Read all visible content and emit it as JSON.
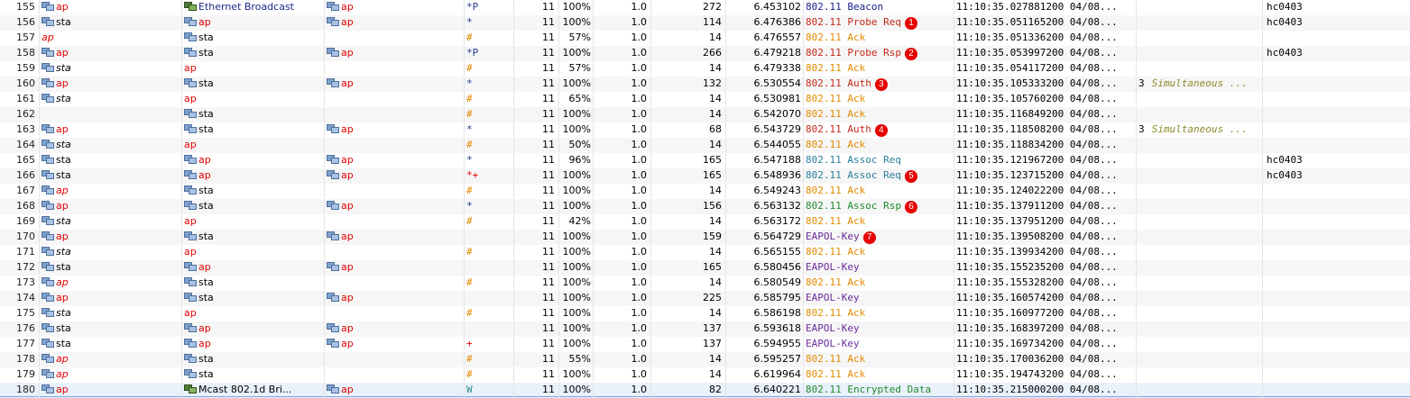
{
  "colors": {
    "address_red": "#e00000",
    "address_plain": "#222222",
    "marker_red": "#e60000",
    "protocol_dark": "#19218a",
    "protocol_red": "#c42a1a",
    "protocol_orange": "#e38a00",
    "protocol_teal": "#2a7f9a",
    "protocol_green": "#1f8a2a",
    "protocol_purple": "#6b2b9c"
  },
  "rows": [
    {
      "no": "155",
      "src": "ap",
      "src_style": "red",
      "src_icon": "node-icon",
      "dst": "Ethernet Broadcast",
      "dst_style": "navy",
      "dst_icon": "broadcast-icon",
      "bssid": "ap",
      "bssid_style": "red",
      "flags": "*P",
      "flag_style": "flag-blue",
      "ch": "11",
      "sig": "100%",
      "rate": "1.0",
      "size": "272",
      "time": "6.453102",
      "proto": "802.11 Beacon",
      "proto_style": "pr-dark",
      "ts": "11:10:35.027881200 04/08...",
      "expert": "",
      "ssid": "Beacon",
      "ssid2": "hc0403",
      "marker": ""
    },
    {
      "no": "156",
      "src": "sta",
      "src_style": "plain",
      "src_icon": "node-icon",
      "dst": "ap",
      "dst_style": "red",
      "dst_icon": "node-icon",
      "bssid": "ap",
      "bssid_style": "red",
      "flags": "*",
      "flag_style": "flag-blue",
      "ch": "11",
      "sig": "100%",
      "rate": "1.0",
      "size": "114",
      "time": "6.476386",
      "proto": "802.11 Probe Req",
      "proto_style": "pr-red",
      "ts": "11:10:35.051165200 04/08...",
      "expert": "",
      "ssid": "",
      "ssid2": "hc0403",
      "marker": "1"
    },
    {
      "no": "157",
      "src": "ap",
      "src_style": "red-ital",
      "src_icon": "",
      "dst": "sta",
      "dst_style": "plain",
      "dst_icon": "node-icon",
      "bssid": "",
      "bssid_style": "",
      "flags": "#",
      "flag_style": "flag-orange",
      "ch": "11",
      "sig": "57%",
      "rate": "1.0",
      "size": "14",
      "time": "6.476557",
      "proto": "802.11 Ack",
      "proto_style": "pr-orange",
      "ts": "11:10:35.051336200 04/08...",
      "expert": "",
      "ssid": "",
      "ssid2": "",
      "marker": ""
    },
    {
      "no": "158",
      "src": "ap",
      "src_style": "red",
      "src_icon": "node-icon",
      "dst": "sta",
      "dst_style": "plain",
      "dst_icon": "node-icon",
      "bssid": "ap",
      "bssid_style": "red",
      "flags": "*P",
      "flag_style": "flag-blue",
      "ch": "11",
      "sig": "100%",
      "rate": "1.0",
      "size": "266",
      "time": "6.479218",
      "proto": "802.11 Probe Rsp",
      "proto_style": "pr-red",
      "ts": "11:10:35.053997200 04/08...",
      "expert": "",
      "ssid": "",
      "ssid2": "hc0403",
      "marker": "2"
    },
    {
      "no": "159",
      "src": "sta",
      "src_style": "plain-ital",
      "src_icon": "node-icon",
      "dst": "ap",
      "dst_style": "red",
      "dst_icon": "",
      "bssid": "",
      "bssid_style": "",
      "flags": "#",
      "flag_style": "flag-orange",
      "ch": "11",
      "sig": "57%",
      "rate": "1.0",
      "size": "14",
      "time": "6.479338",
      "proto": "802.11 Ack",
      "proto_style": "pr-orange",
      "ts": "11:10:35.054117200 04/08...",
      "expert": "",
      "ssid": "",
      "ssid2": "",
      "marker": ""
    },
    {
      "no": "160",
      "src": "ap",
      "src_style": "red",
      "src_icon": "node-icon",
      "dst": "sta",
      "dst_style": "plain",
      "dst_icon": "node-icon",
      "bssid": "ap",
      "bssid_style": "red",
      "flags": "*",
      "flag_style": "flag-blue",
      "ch": "11",
      "sig": "100%",
      "rate": "1.0",
      "size": "132",
      "time": "6.530554",
      "proto": "802.11 Auth",
      "proto_style": "pr-red",
      "ts": "11:10:35.105333200 04/08...",
      "expert": "3",
      "expert_text": "Simultaneous ...",
      "ssid": "",
      "ssid2": "",
      "marker": "3"
    },
    {
      "no": "161",
      "src": "sta",
      "src_style": "plain-ital",
      "src_icon": "node-icon",
      "dst": "ap",
      "dst_style": "red",
      "dst_icon": "",
      "bssid": "",
      "bssid_style": "",
      "flags": "#",
      "flag_style": "flag-orange",
      "ch": "11",
      "sig": "65%",
      "rate": "1.0",
      "size": "14",
      "time": "6.530981",
      "proto": "802.11 Ack",
      "proto_style": "pr-orange",
      "ts": "11:10:35.105760200 04/08...",
      "expert": "",
      "ssid": "",
      "ssid2": "",
      "marker": ""
    },
    {
      "no": "162",
      "src": "",
      "src_style": "",
      "src_icon": "",
      "dst": "sta",
      "dst_style": "plain",
      "dst_icon": "node-icon",
      "bssid": "",
      "bssid_style": "",
      "flags": "#",
      "flag_style": "flag-orange",
      "ch": "11",
      "sig": "100%",
      "rate": "1.0",
      "size": "14",
      "time": "6.542070",
      "proto": "802.11 Ack",
      "proto_style": "pr-orange",
      "ts": "11:10:35.116849200 04/08...",
      "expert": "",
      "ssid": "",
      "ssid2": "",
      "marker": ""
    },
    {
      "no": "163",
      "src": "ap",
      "src_style": "red",
      "src_icon": "node-icon",
      "dst": "sta",
      "dst_style": "plain",
      "dst_icon": "node-icon",
      "bssid": "ap",
      "bssid_style": "red",
      "flags": "*",
      "flag_style": "flag-blue",
      "ch": "11",
      "sig": "100%",
      "rate": "1.0",
      "size": "68",
      "time": "6.543729",
      "proto": "802.11 Auth",
      "proto_style": "pr-red",
      "ts": "11:10:35.118508200 04/08...",
      "expert": "3",
      "expert_text": "Simultaneous ...",
      "ssid": "",
      "ssid2": "",
      "marker": "4"
    },
    {
      "no": "164",
      "src": "sta",
      "src_style": "plain-ital",
      "src_icon": "node-icon",
      "dst": "ap",
      "dst_style": "red",
      "dst_icon": "",
      "bssid": "",
      "bssid_style": "",
      "flags": "#",
      "flag_style": "flag-orange",
      "ch": "11",
      "sig": "50%",
      "rate": "1.0",
      "size": "14",
      "time": "6.544055",
      "proto": "802.11 Ack",
      "proto_style": "pr-orange",
      "ts": "11:10:35.118834200 04/08...",
      "expert": "",
      "ssid": "",
      "ssid2": "",
      "marker": ""
    },
    {
      "no": "165",
      "src": "sta",
      "src_style": "plain",
      "src_icon": "node-icon",
      "dst": "ap",
      "dst_style": "red",
      "dst_icon": "node-icon",
      "bssid": "ap",
      "bssid_style": "red",
      "flags": "*",
      "flag_style": "flag-blue",
      "ch": "11",
      "sig": "96%",
      "rate": "1.0",
      "size": "165",
      "time": "6.547188",
      "proto": "802.11 Assoc Req",
      "proto_style": "pr-teal",
      "ts": "11:10:35.121967200 04/08...",
      "expert": "",
      "ssid": "",
      "ssid2": "hc0403",
      "marker": ""
    },
    {
      "no": "166",
      "src": "sta",
      "src_style": "plain",
      "src_icon": "node-icon",
      "dst": "ap",
      "dst_style": "red",
      "dst_icon": "node-icon",
      "bssid": "ap",
      "bssid_style": "red",
      "flags": "*+",
      "flag_style": "flag-red",
      "ch": "11",
      "sig": "100%",
      "rate": "1.0",
      "size": "165",
      "time": "6.548936",
      "proto": "802.11 Assoc Req",
      "proto_style": "pr-teal",
      "ts": "11:10:35.123715200 04/08...",
      "expert": "",
      "ssid": "",
      "ssid2": "hc0403",
      "marker": "5"
    },
    {
      "no": "167",
      "src": "ap",
      "src_style": "red-ital",
      "src_icon": "node-icon",
      "dst": "sta",
      "dst_style": "plain",
      "dst_icon": "node-icon",
      "bssid": "",
      "bssid_style": "",
      "flags": "#",
      "flag_style": "flag-orange",
      "ch": "11",
      "sig": "100%",
      "rate": "1.0",
      "size": "14",
      "time": "6.549243",
      "proto": "802.11 Ack",
      "proto_style": "pr-orange",
      "ts": "11:10:35.124022200 04/08...",
      "expert": "",
      "ssid": "",
      "ssid2": "",
      "marker": ""
    },
    {
      "no": "168",
      "src": "ap",
      "src_style": "red",
      "src_icon": "node-icon",
      "dst": "sta",
      "dst_style": "plain",
      "dst_icon": "node-icon",
      "bssid": "ap",
      "bssid_style": "red",
      "flags": "*",
      "flag_style": "flag-blue",
      "ch": "11",
      "sig": "100%",
      "rate": "1.0",
      "size": "156",
      "time": "6.563132",
      "proto": "802.11 Assoc Rsp",
      "proto_style": "pr-green",
      "ts": "11:10:35.137911200 04/08...",
      "expert": "",
      "ssid": "",
      "ssid2": "",
      "marker": "6"
    },
    {
      "no": "169",
      "src": "sta",
      "src_style": "plain-ital",
      "src_icon": "node-icon",
      "dst": "ap",
      "dst_style": "red",
      "dst_icon": "",
      "bssid": "",
      "bssid_style": "",
      "flags": "#",
      "flag_style": "flag-orange",
      "ch": "11",
      "sig": "42%",
      "rate": "1.0",
      "size": "14",
      "time": "6.563172",
      "proto": "802.11 Ack",
      "proto_style": "pr-orange",
      "ts": "11:10:35.137951200 04/08...",
      "expert": "",
      "ssid": "",
      "ssid2": "",
      "marker": ""
    },
    {
      "no": "170",
      "src": "ap",
      "src_style": "red",
      "src_icon": "node-icon",
      "dst": "sta",
      "dst_style": "plain",
      "dst_icon": "node-icon",
      "bssid": "ap",
      "bssid_style": "red",
      "flags": "",
      "flag_style": "",
      "ch": "11",
      "sig": "100%",
      "rate": "1.0",
      "size": "159",
      "time": "6.564729",
      "proto": "EAPOL-Key",
      "proto_style": "pr-purple",
      "ts": "11:10:35.139508200 04/08...",
      "expert": "",
      "ssid": "",
      "ssid2": "",
      "marker": "7"
    },
    {
      "no": "171",
      "src": "sta",
      "src_style": "plain-ital",
      "src_icon": "node-icon",
      "dst": "ap",
      "dst_style": "red",
      "dst_icon": "",
      "bssid": "",
      "bssid_style": "",
      "flags": "#",
      "flag_style": "flag-orange",
      "ch": "11",
      "sig": "100%",
      "rate": "1.0",
      "size": "14",
      "time": "6.565155",
      "proto": "802.11 Ack",
      "proto_style": "pr-orange",
      "ts": "11:10:35.139934200 04/08...",
      "expert": "",
      "ssid": "",
      "ssid2": "",
      "marker": ""
    },
    {
      "no": "172",
      "src": "sta",
      "src_style": "plain",
      "src_icon": "node-icon",
      "dst": "ap",
      "dst_style": "red",
      "dst_icon": "node-icon",
      "bssid": "ap",
      "bssid_style": "red",
      "flags": "",
      "flag_style": "",
      "ch": "11",
      "sig": "100%",
      "rate": "1.0",
      "size": "165",
      "time": "6.580456",
      "proto": "EAPOL-Key",
      "proto_style": "pr-purple",
      "ts": "11:10:35.155235200 04/08...",
      "expert": "",
      "ssid": "",
      "ssid2": "",
      "marker": ""
    },
    {
      "no": "173",
      "src": "ap",
      "src_style": "red-ital",
      "src_icon": "node-icon",
      "dst": "sta",
      "dst_style": "plain",
      "dst_icon": "node-icon",
      "bssid": "",
      "bssid_style": "",
      "flags": "#",
      "flag_style": "flag-orange",
      "ch": "11",
      "sig": "100%",
      "rate": "1.0",
      "size": "14",
      "time": "6.580549",
      "proto": "802.11 Ack",
      "proto_style": "pr-orange",
      "ts": "11:10:35.155328200 04/08...",
      "expert": "",
      "ssid": "",
      "ssid2": "",
      "marker": ""
    },
    {
      "no": "174",
      "src": "ap",
      "src_style": "red",
      "src_icon": "node-icon",
      "dst": "sta",
      "dst_style": "plain",
      "dst_icon": "node-icon",
      "bssid": "ap",
      "bssid_style": "red",
      "flags": "",
      "flag_style": "",
      "ch": "11",
      "sig": "100%",
      "rate": "1.0",
      "size": "225",
      "time": "6.585795",
      "proto": "EAPOL-Key",
      "proto_style": "pr-purple",
      "ts": "11:10:35.160574200 04/08...",
      "expert": "",
      "ssid": "",
      "ssid2": "",
      "marker": ""
    },
    {
      "no": "175",
      "src": "sta",
      "src_style": "plain-ital",
      "src_icon": "node-icon",
      "dst": "ap",
      "dst_style": "red",
      "dst_icon": "",
      "bssid": "",
      "bssid_style": "",
      "flags": "#",
      "flag_style": "flag-orange",
      "ch": "11",
      "sig": "100%",
      "rate": "1.0",
      "size": "14",
      "time": "6.586198",
      "proto": "802.11 Ack",
      "proto_style": "pr-orange",
      "ts": "11:10:35.160977200 04/08...",
      "expert": "",
      "ssid": "",
      "ssid2": "",
      "marker": ""
    },
    {
      "no": "176",
      "src": "sta",
      "src_style": "plain",
      "src_icon": "node-icon",
      "dst": "ap",
      "dst_style": "red",
      "dst_icon": "node-icon",
      "bssid": "ap",
      "bssid_style": "red",
      "flags": "",
      "flag_style": "",
      "ch": "11",
      "sig": "100%",
      "rate": "1.0",
      "size": "137",
      "time": "6.593618",
      "proto": "EAPOL-Key",
      "proto_style": "pr-purple",
      "ts": "11:10:35.168397200 04/08...",
      "expert": "",
      "ssid": "",
      "ssid2": "",
      "marker": ""
    },
    {
      "no": "177",
      "src": "sta",
      "src_style": "plain",
      "src_icon": "node-icon",
      "dst": "ap",
      "dst_style": "red",
      "dst_icon": "node-icon",
      "bssid": "ap",
      "bssid_style": "red",
      "flags": "+",
      "flag_style": "flag-red",
      "ch": "11",
      "sig": "100%",
      "rate": "1.0",
      "size": "137",
      "time": "6.594955",
      "proto": "EAPOL-Key",
      "proto_style": "pr-purple",
      "ts": "11:10:35.169734200 04/08...",
      "expert": "",
      "ssid": "",
      "ssid2": "",
      "marker": ""
    },
    {
      "no": "178",
      "src": "ap",
      "src_style": "red-ital",
      "src_icon": "node-icon",
      "dst": "sta",
      "dst_style": "plain",
      "dst_icon": "node-icon",
      "bssid": "",
      "bssid_style": "",
      "flags": "#",
      "flag_style": "flag-orange",
      "ch": "11",
      "sig": "55%",
      "rate": "1.0",
      "size": "14",
      "time": "6.595257",
      "proto": "802.11 Ack",
      "proto_style": "pr-orange",
      "ts": "11:10:35.170036200 04/08...",
      "expert": "",
      "ssid": "",
      "ssid2": "",
      "marker": ""
    },
    {
      "no": "179",
      "src": "ap",
      "src_style": "red-ital",
      "src_icon": "node-icon",
      "dst": "sta",
      "dst_style": "plain",
      "dst_icon": "node-icon",
      "bssid": "",
      "bssid_style": "",
      "flags": "#",
      "flag_style": "flag-orange",
      "ch": "11",
      "sig": "100%",
      "rate": "1.0",
      "size": "14",
      "time": "6.619964",
      "proto": "802.11 Ack",
      "proto_style": "pr-orange",
      "ts": "11:10:35.194743200 04/08...",
      "expert": "",
      "ssid": "",
      "ssid2": "",
      "marker": ""
    },
    {
      "no": "180",
      "src": "ap",
      "src_style": "red",
      "src_icon": "node-icon",
      "dst": "Mcast 802.1d Bri...",
      "dst_style": "plain",
      "dst_icon": "broadcast-icon",
      "bssid": "ap",
      "bssid_style": "red",
      "flags": "W",
      "flag_style": "flag-teal",
      "ch": "11",
      "sig": "100%",
      "rate": "1.0",
      "size": "82",
      "time": "6.640221",
      "proto": "802.11 Encrypted Data",
      "proto_style": "pr-green",
      "ts": "11:10:35.215000200 04/08...",
      "expert": "",
      "ssid": "",
      "ssid2": "",
      "marker": ""
    }
  ]
}
